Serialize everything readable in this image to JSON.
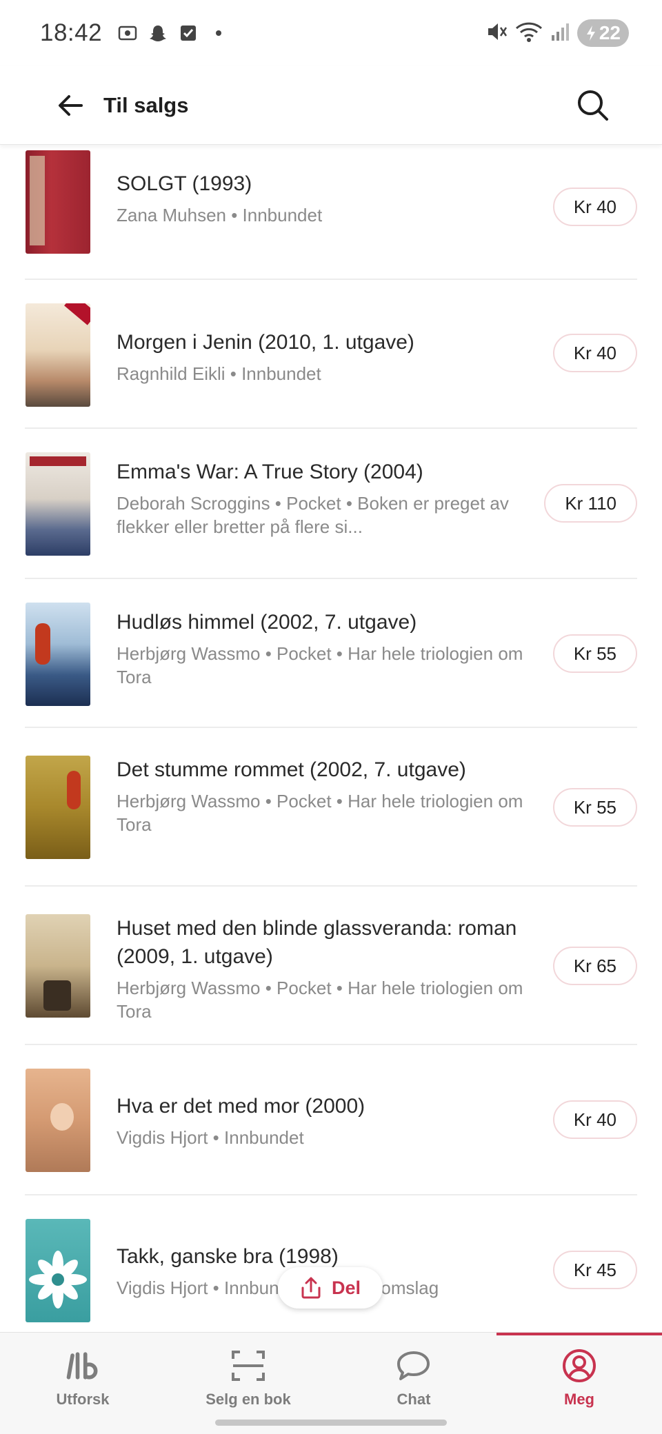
{
  "status_bar": {
    "time": "18:42",
    "battery": "22"
  },
  "app_bar": {
    "title": "Til salgs"
  },
  "books": [
    {
      "title": "SOLGT (1993)",
      "meta": "Zana Muhsen • Innbundet",
      "price": "Kr 40"
    },
    {
      "title": "Morgen i Jenin (2010, 1. utgave)",
      "meta": "Ragnhild Eikli • Innbundet",
      "price": "Kr 40"
    },
    {
      "title": "Emma's War: A True Story (2004)",
      "meta": "Deborah Scroggins • Pocket • Boken er preget av flekker eller bretter på flere si...",
      "price": "Kr 110"
    },
    {
      "title": "Hudløs himmel (2002, 7. utgave)",
      "meta": "Herbjørg Wassmo • Pocket • Har hele triologien om Tora",
      "price": "Kr 55"
    },
    {
      "title": "Det stumme rommet (2002, 7. utgave)",
      "meta": "Herbjørg Wassmo • Pocket • Har hele triologien om Tora",
      "price": "Kr 55"
    },
    {
      "title": "Huset med den blinde glassveranda: roman (2009, 1. utgave)",
      "meta": "Herbjørg Wassmo • Pocket • Har hele triologien om Tora",
      "price": "Kr 65"
    },
    {
      "title": "Hva er det med mor (2000)",
      "meta": "Vigdis Hjort • Innbundet",
      "price": "Kr 40"
    },
    {
      "title": "Takk, ganske bra (1998)",
      "meta": "Vigdis Hjort • Innbundet • Litt slitt omslag",
      "price": "Kr 45"
    }
  ],
  "share_button": {
    "label": "Del"
  },
  "tabs": [
    {
      "label": "Utforsk",
      "icon": "explore-logo-icon"
    },
    {
      "label": "Selg en bok",
      "icon": "scan-icon"
    },
    {
      "label": "Chat",
      "icon": "chat-bubble-icon"
    },
    {
      "label": "Meg",
      "icon": "profile-icon"
    }
  ],
  "colors": {
    "accent": "#c8334f",
    "price_border": "#f2d7da"
  }
}
